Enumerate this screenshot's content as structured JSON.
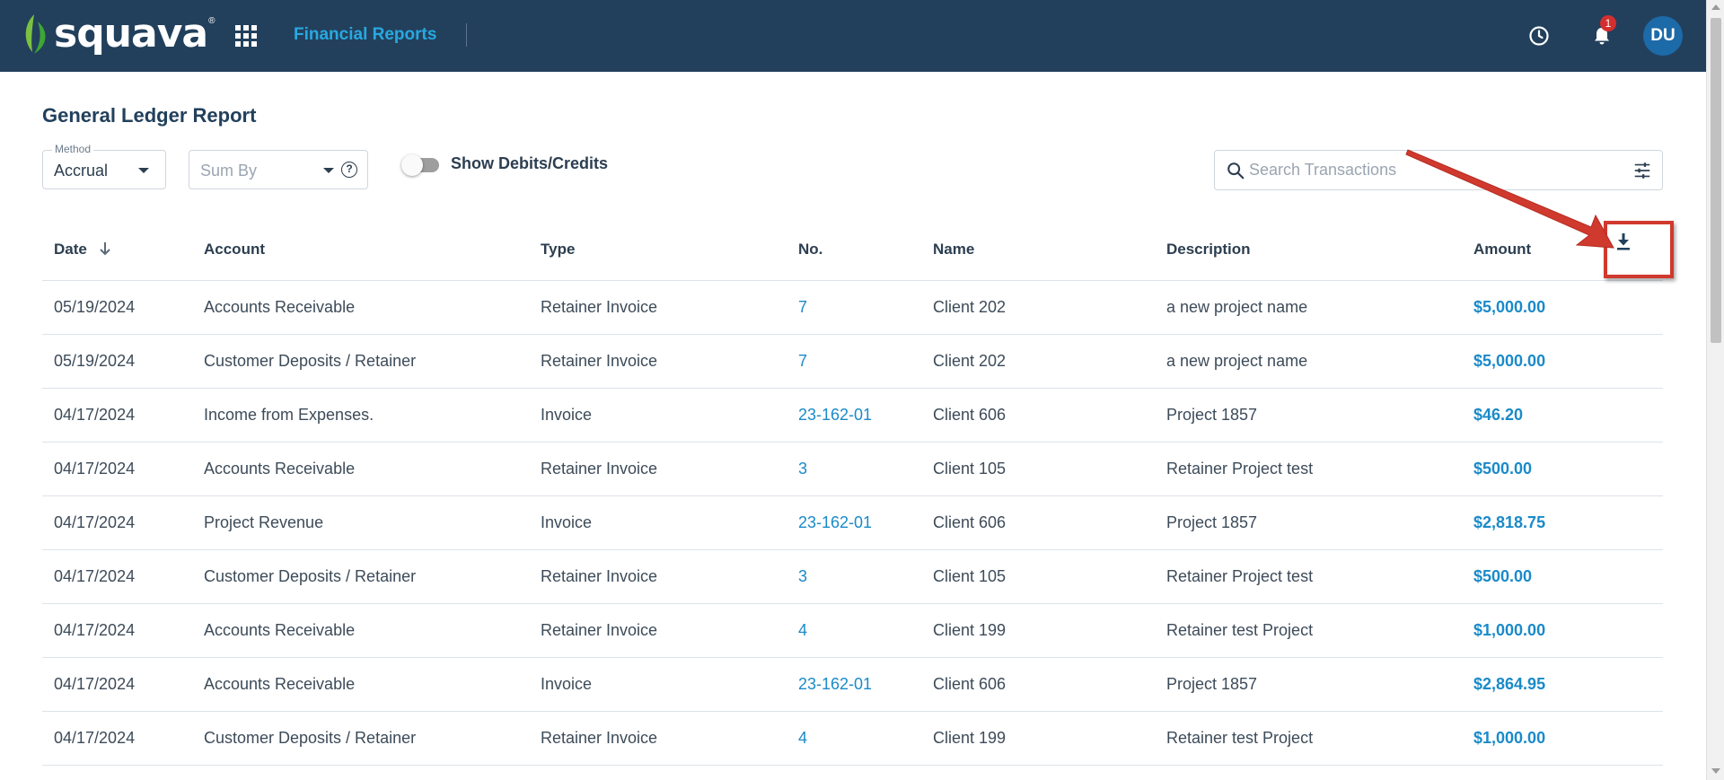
{
  "header": {
    "brand": "squava",
    "registered_mark": "®",
    "module_title": "Financial Reports",
    "notification_count": "1",
    "user_initials": "DU"
  },
  "page": {
    "title": "General Ledger Report"
  },
  "filters": {
    "method_label": "Method",
    "method_value": "Accrual",
    "sumby_placeholder": "Sum By",
    "help_glyph": "?",
    "toggle_label": "Show Debits/Credits",
    "toggle_on": false,
    "search_placeholder": "Search Transactions"
  },
  "table": {
    "columns": [
      "Date",
      "Account",
      "Type",
      "No.",
      "Name",
      "Description",
      "Amount"
    ],
    "sorted_column": "Date",
    "sort_direction": "descending",
    "rows": [
      {
        "date": "05/19/2024",
        "account": "Accounts Receivable",
        "type": "Retainer Invoice",
        "no": "7",
        "name": "Client 202",
        "description": "a new project name",
        "amount": "$5,000.00"
      },
      {
        "date": "05/19/2024",
        "account": "Customer Deposits / Retainer",
        "type": "Retainer Invoice",
        "no": "7",
        "name": "Client 202",
        "description": "a new project name",
        "amount": "$5,000.00"
      },
      {
        "date": "04/17/2024",
        "account": "Income from Expenses.",
        "type": "Invoice",
        "no": "23-162-01",
        "name": "Client 606",
        "description": "Project 1857",
        "amount": "$46.20"
      },
      {
        "date": "04/17/2024",
        "account": "Accounts Receivable",
        "type": "Retainer Invoice",
        "no": "3",
        "name": "Client 105",
        "description": "Retainer Project test",
        "amount": "$500.00"
      },
      {
        "date": "04/17/2024",
        "account": "Project Revenue",
        "type": "Invoice",
        "no": "23-162-01",
        "name": "Client 606",
        "description": "Project 1857",
        "amount": "$2,818.75"
      },
      {
        "date": "04/17/2024",
        "account": "Customer Deposits / Retainer",
        "type": "Retainer Invoice",
        "no": "3",
        "name": "Client 105",
        "description": "Retainer Project test",
        "amount": "$500.00"
      },
      {
        "date": "04/17/2024",
        "account": "Accounts Receivable",
        "type": "Retainer Invoice",
        "no": "4",
        "name": "Client 199",
        "description": "Retainer test Project",
        "amount": "$1,000.00"
      },
      {
        "date": "04/17/2024",
        "account": "Accounts Receivable",
        "type": "Invoice",
        "no": "23-162-01",
        "name": "Client 606",
        "description": "Project 1857",
        "amount": "$2,864.95"
      },
      {
        "date": "04/17/2024",
        "account": "Customer Deposits / Retainer",
        "type": "Retainer Invoice",
        "no": "4",
        "name": "Client 199",
        "description": "Retainer test Project",
        "amount": "$1,000.00"
      }
    ]
  },
  "icons": {
    "apps": "grid-icon",
    "recent": "clock-icon",
    "notifications": "bell-icon",
    "search": "search-icon",
    "filters": "sliders-icon",
    "download": "download-icon",
    "sort": "arrow-down-icon"
  },
  "colors": {
    "header_bg": "#22405c",
    "accent": "#29a8e0",
    "link": "#1a8ac9",
    "badge": "#d32f2f",
    "avatar_bg": "#1d6aa8",
    "annotation": "#d0392d"
  }
}
